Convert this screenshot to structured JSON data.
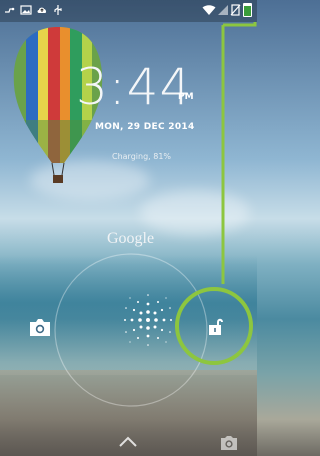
{
  "statusbar": {
    "left_icons": [
      "usb-debug-icon",
      "image-icon",
      "cloud-upload-icon",
      "usb-icon"
    ],
    "right_icons": [
      "wifi-icon",
      "signal-icon",
      "no-sim-icon",
      "battery-icon"
    ],
    "battery_label": "81%"
  },
  "clock": {
    "time": "3:44",
    "ampm": "PM"
  },
  "date": "MON, 29 DEC 2014",
  "charging": "Charging, 81%",
  "google_label": "Google",
  "colors": {
    "highlight": "#8dc63f",
    "text": "#ffffff"
  },
  "icons": {
    "camera_left": "camera-icon",
    "unlock": "unlock-padlock-icon",
    "chevron": "chevron-up-icon",
    "camera_bottom_right": "camera-icon"
  }
}
